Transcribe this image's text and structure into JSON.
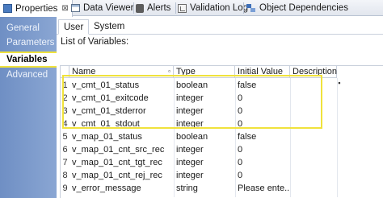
{
  "tabs": [
    {
      "label": "Properties",
      "icon": "properties-icon",
      "close": "⊠"
    },
    {
      "label": "Data Viewer",
      "icon": "data-viewer-icon"
    },
    {
      "label": "Alerts",
      "icon": "alerts-icon"
    },
    {
      "label": "Validation Log",
      "icon": "validation-log-icon"
    },
    {
      "label": "Object Dependencies",
      "icon": "object-dependencies-icon"
    }
  ],
  "sidebar": {
    "items": [
      {
        "label": "General"
      },
      {
        "label": "Parameters"
      },
      {
        "label": "Variables",
        "selected": true
      },
      {
        "label": "Advanced"
      }
    ]
  },
  "subtabs": [
    {
      "label": "User",
      "active": true
    },
    {
      "label": "System"
    }
  ],
  "list_label": "List of Variables:",
  "columns": [
    "Name",
    "Type",
    "Initial Value",
    "Description"
  ],
  "rows": [
    {
      "num": "1",
      "name": "v_cmt_01_status",
      "type": "boolean",
      "init": "false",
      "desc": ""
    },
    {
      "num": "2",
      "name": "v_cmt_01_exitcode",
      "type": "integer",
      "init": "0",
      "desc": ""
    },
    {
      "num": "3",
      "name": "v_cmt_01_stderror",
      "type": "integer",
      "init": "0",
      "desc": ""
    },
    {
      "num": "4",
      "name": "v_cmt_01_stdout",
      "type": "integer",
      "init": "0",
      "desc": ""
    },
    {
      "num": "5",
      "name": "v_map_01_status",
      "type": "boolean",
      "init": "false",
      "desc": ""
    },
    {
      "num": "6",
      "name": "v_map_01_cnt_src_rec",
      "type": "integer",
      "init": "0",
      "desc": ""
    },
    {
      "num": "7",
      "name": "v_map_01_cnt_tgt_rec",
      "type": "integer",
      "init": "0",
      "desc": ""
    },
    {
      "num": "8",
      "name": "v_map_01_cnt_rej_rec",
      "type": "integer",
      "init": "0",
      "desc": ""
    },
    {
      "num": "9",
      "name": "v_error_message",
      "type": "string",
      "init": "Please ente...",
      "desc": ""
    }
  ],
  "colors": {
    "highlight": "#f0e23c",
    "sidebar": "#7b98c9"
  }
}
